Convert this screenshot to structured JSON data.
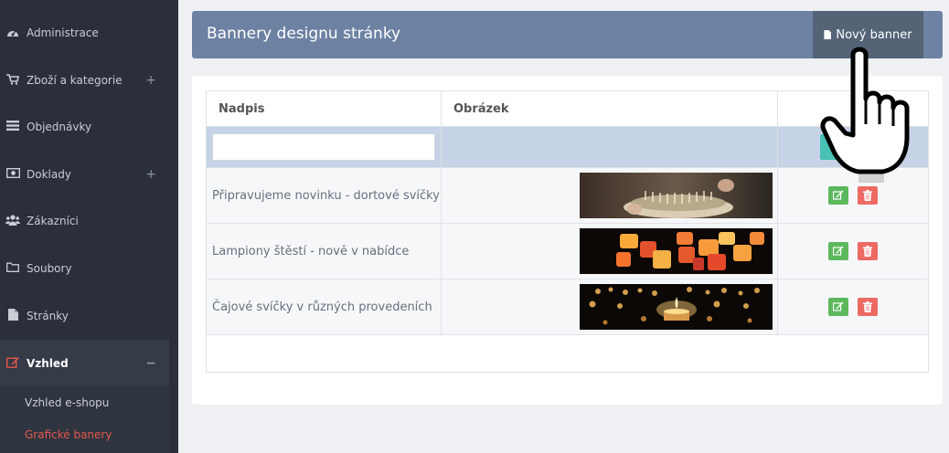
{
  "sidebar": {
    "items": [
      {
        "label": "Administrace",
        "icon": "dashboard-icon"
      },
      {
        "label": "Zboží a kategorie",
        "icon": "cart-icon",
        "expandable": "+"
      },
      {
        "label": "Objednávky",
        "icon": "list-icon"
      },
      {
        "label": "Doklady",
        "icon": "money-icon",
        "expandable": "+"
      },
      {
        "label": "Zákazníci",
        "icon": "users-icon"
      },
      {
        "label": "Soubory",
        "icon": "folder-icon"
      },
      {
        "label": "Stránky",
        "icon": "file-icon"
      },
      {
        "label": "Vzhled",
        "icon": "edit-icon",
        "expandable": "−"
      }
    ],
    "subitems": [
      {
        "label": "Vzhled e-shopu"
      },
      {
        "label": "Grafické banery"
      }
    ]
  },
  "header": {
    "title": "Bannery designu stránky",
    "new_button": "Nový banner"
  },
  "table": {
    "columns": [
      "Nadpis",
      "Obrázek",
      ""
    ],
    "filter_button": "F",
    "rows": [
      {
        "title": "Připravujeme novinku - dortové svíčky",
        "image": "cake-candles-photo"
      },
      {
        "title": "Lampiony štěstí - nově v nabídce",
        "image": "lanterns-photo"
      },
      {
        "title": "Čajové svíčky v různých provedeních",
        "image": "tea-candles-photo"
      }
    ]
  },
  "colors": {
    "sidebar_bg": "#2a2f3a",
    "header_bg": "#6d82a3",
    "accent_red": "#e3574c",
    "edit_green": "#5cb85c",
    "delete_red": "#ec6a63",
    "filter_teal": "#48c2b3"
  }
}
